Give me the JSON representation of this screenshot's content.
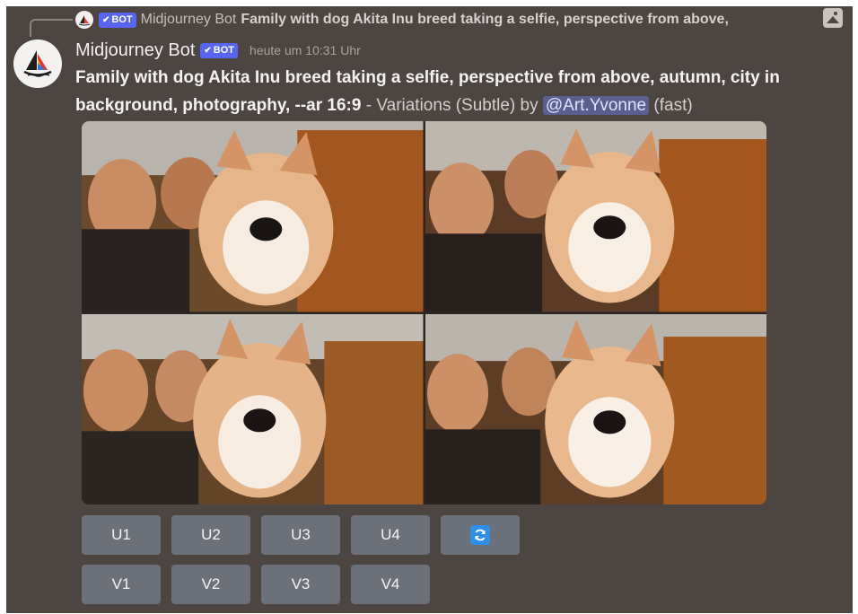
{
  "reply": {
    "bot_badge": "BOT",
    "author": "Midjourney Bot",
    "text": "Family with dog Akita Inu breed taking a selfie, perspective from above,",
    "icon": "image-icon"
  },
  "message": {
    "author": "Midjourney Bot",
    "bot_badge": "BOT",
    "timestamp": "heute um 10:31 Uhr",
    "prompt": "Family with dog Akita Inu breed taking a selfie, perspective from above, autumn, city in background, photography, --ar 16:9",
    "separator": " - ",
    "variation_text": "Variations (Subtle) by ",
    "mention": "@Art.Yvonne",
    "speed": " (fast)"
  },
  "images": {
    "description_icon": "image-grid"
  },
  "buttons": {
    "upscale": [
      "U1",
      "U2",
      "U3",
      "U4"
    ],
    "variation": [
      "V1",
      "V2",
      "V3",
      "V4"
    ],
    "reroll_icon": "refresh-icon"
  },
  "colors": {
    "background": "#4c4541",
    "bot_badge": "#5865f2",
    "button": "#6b7079",
    "refresh": "#2d8fe6"
  }
}
